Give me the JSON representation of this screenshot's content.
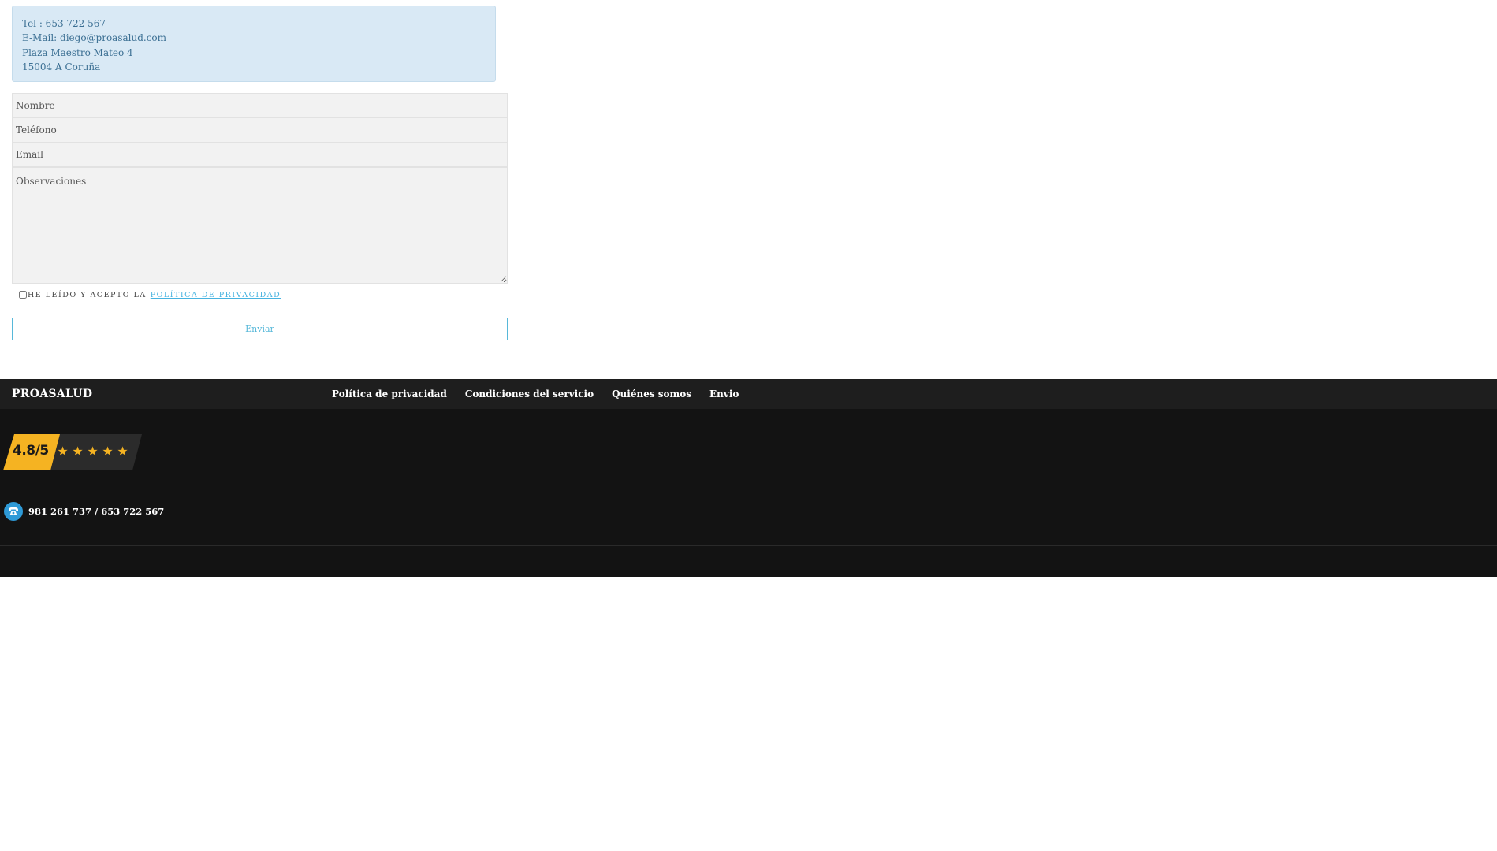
{
  "contact": {
    "tel": "Tel : 653 722 567",
    "email": "E-Mail: diego@proasalud.com",
    "address": "Plaza Maestro Mateo 4",
    "city": "15004 A Coruña"
  },
  "form": {
    "nombre_placeholder": "Nombre",
    "telefono_placeholder": "Teléfono",
    "email_placeholder": "Email",
    "observaciones_placeholder": "Observaciones",
    "consent_text": "HE LEÍDO Y ACEPTO LA",
    "privacy_link": "POLÍTICA DE PRIVACIDAD",
    "submit_label": "Enviar"
  },
  "footer": {
    "brand": "PROASALUD",
    "nav": [
      "Política de privacidad",
      "Condiciones del servicio",
      "Quiénes somos",
      "Envio"
    ],
    "rating": {
      "score_text": "4.8/5",
      "stars": 5,
      "star_color": "#f5b322",
      "badge_color": "#f5b322"
    },
    "phone_icon": "phone-icon",
    "phones": "981 261 737  / 653 722 567"
  },
  "colors": {
    "accent": "#57b8d9",
    "info_bg": "#d9e9f5",
    "footer_bg": "#131313",
    "footer_bar_bg": "#1e1e1e"
  }
}
